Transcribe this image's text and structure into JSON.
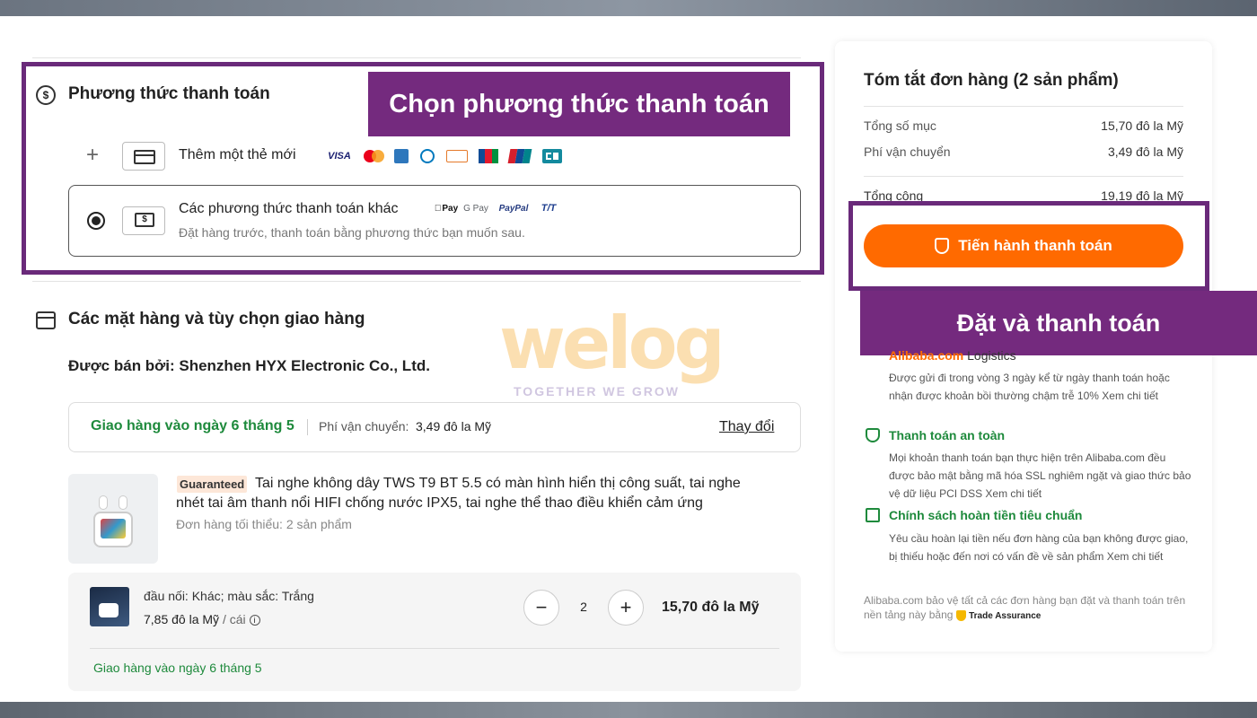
{
  "payment": {
    "title": "Phương thức thanh toán",
    "add_card_label": "Thêm một thẻ mới",
    "card_brands": [
      "VISA",
      "MC",
      "AMEX",
      "DC",
      "DISCOVER",
      "JCB",
      "UP",
      "CB"
    ],
    "other_label": "Các phương thức thanh toán khác",
    "other_brands": [
      "Pay",
      "G Pay",
      "PayPal",
      "T/T"
    ],
    "other_sub": "Đặt hàng trước, thanh toán bằng phương thức bạn muốn sau."
  },
  "annotations": {
    "choose_payment": "Chọn phương thức thanh toán",
    "place_and_pay": "Đặt và thanh toán"
  },
  "items": {
    "title": "Các mặt hàng và tùy chọn giao hàng",
    "seller": "Được bán bởi: Shenzhen HYX Electronic Co., Ltd.",
    "delivery_date": "Giao hàng vào ngày 6 tháng 5",
    "shipping_fee_label": "Phí vận chuyển:",
    "shipping_fee_value": "3,49 đô la Mỹ",
    "change_link": "Thay đổi",
    "product": {
      "badge": "Guaranteed",
      "title_line1": "Tai nghe không dây TWS T9 BT 5.5 có màn hình hiển thị công suất, tai nghe",
      "title_line2": "nhét tai âm thanh nổi HIFI chống nước IPX5, tai nghe thể thao điều khiển cảm ứng",
      "moq": "Đơn hàng tối thiểu:  2  sản phẩm"
    },
    "variant": {
      "spec": "đầu nối: Khác; màu sắc: Trắng",
      "price": "7,85 đô la Mỹ",
      "unit": " / cái",
      "quantity": "2",
      "line_total": "15,70 đô la Mỹ",
      "delivery": "Giao hàng vào ngày 6 tháng 5"
    }
  },
  "watermark": {
    "logo": "welog",
    "tagline": "TOGETHER WE GROW"
  },
  "summary": {
    "title": "Tóm tắt đơn hàng (2 sản phẩm)",
    "subtotal_label": "Tổng số mục",
    "subtotal_value": "15,70 đô la Mỹ",
    "shipping_label": "Phí vận chuyển",
    "shipping_value": "3,49 đô la Mỹ",
    "total_label": "Tổng cộng",
    "total_value": "19,19 đô la Mỹ",
    "checkout_button": "Tiến hành thanh toán",
    "logistics_brand": "Alibaba.com",
    "logistics_label": " Logistics",
    "logistics_text": "Được gửi đi trong vòng 3 ngày kể từ ngày thanh toán hoặc nhận được khoản bồi thường chậm trễ 10% Xem chi tiết",
    "secure_title": "Thanh toán an toàn",
    "secure_text": "Mọi khoản thanh toán bạn thực hiện trên Alibaba.com đều được bảo mật bằng mã hóa SSL nghiêm ngặt và giao thức bảo vệ dữ liệu PCI DSS Xem chi tiết",
    "refund_title": "Chính sách hoàn tiền tiêu chuẩn",
    "refund_text": "Yêu cầu hoàn lại tiền nếu đơn hàng của bạn không được giao, bị thiếu hoặc đến nơi có vấn đề về sản phẩm Xem chi tiết",
    "footer_text": "Alibaba.com bảo vệ tất cả các đơn hàng bạn đặt và thanh toán trên nền tảng này bằng ",
    "trade_assurance": "Trade Assurance"
  },
  "colors": {
    "accent_orange": "#ff6a00",
    "annotation_purple": "#742a7e",
    "success_green": "#1e8a3c"
  }
}
